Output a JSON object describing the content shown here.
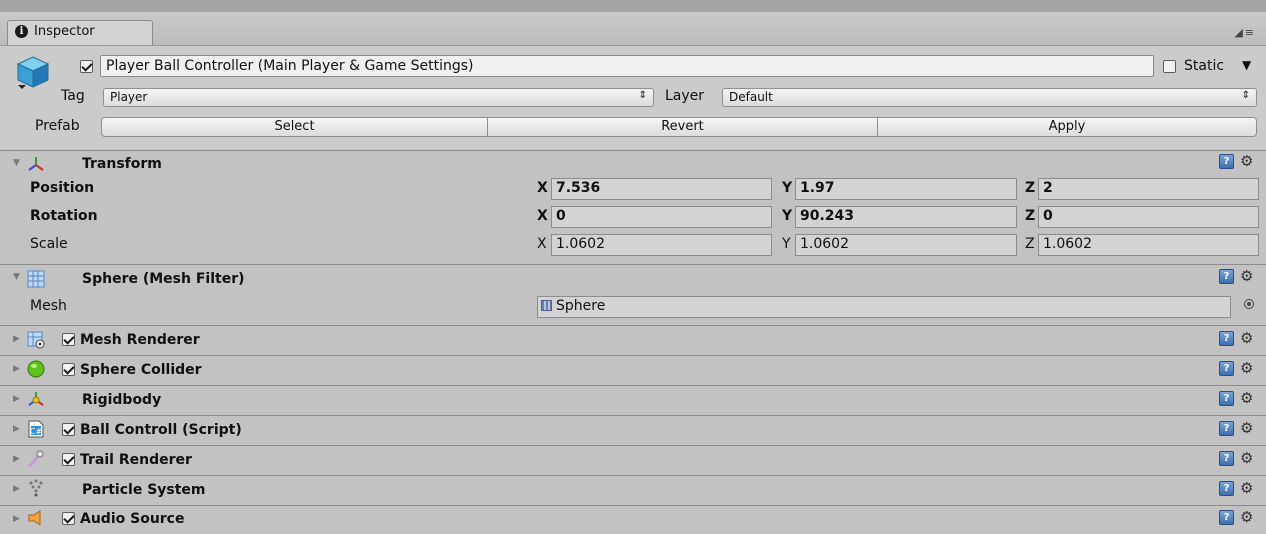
{
  "tab": {
    "title": "Inspector",
    "lock_icon": "lock-icon",
    "menu_icon": "tab-menu-icon"
  },
  "header": {
    "object_name": "Player Ball Controller (Main Player & Game Settings)",
    "active": true,
    "static_label": "Static",
    "static_checked": false,
    "tag_label": "Tag",
    "tag_value": "Player",
    "layer_label": "Layer",
    "layer_value": "Default",
    "prefab_label": "Prefab",
    "prefab_buttons": {
      "select": "Select",
      "revert": "Revert",
      "apply": "Apply"
    }
  },
  "transform": {
    "title": "Transform",
    "position": {
      "label": "Position",
      "x": "7.536",
      "y": "1.97",
      "z": "2"
    },
    "rotation": {
      "label": "Rotation",
      "x": "0",
      "y": "90.243",
      "z": "0"
    },
    "scale": {
      "label": "Scale",
      "x": "1.0602",
      "y": "1.0602",
      "z": "1.0602"
    },
    "axes": {
      "x": "X",
      "y": "Y",
      "z": "Z"
    }
  },
  "mesh_filter": {
    "title": "Sphere (Mesh Filter)",
    "mesh_label": "Mesh",
    "mesh_value": "Sphere"
  },
  "components": [
    {
      "title": "Mesh Renderer",
      "enabled": true,
      "icon": "mesh-renderer-icon"
    },
    {
      "title": "Sphere Collider",
      "enabled": true,
      "icon": "sphere-collider-icon"
    },
    {
      "title": "Rigidbody",
      "enabled": null,
      "icon": "rigidbody-icon"
    },
    {
      "title": "Ball Controll (Script)",
      "enabled": true,
      "icon": "csharp-script-icon"
    },
    {
      "title": "Trail Renderer",
      "enabled": true,
      "icon": "trail-renderer-icon"
    },
    {
      "title": "Particle System",
      "enabled": null,
      "icon": "particle-system-icon"
    },
    {
      "title": "Audio Source",
      "enabled": true,
      "icon": "audio-source-icon"
    }
  ],
  "colors": {
    "panel_bg": "#c2c2c2",
    "header_bg": "#cbcbcb",
    "field_bg": "#d3d3d3",
    "help_blue": "#3f6fb0"
  }
}
